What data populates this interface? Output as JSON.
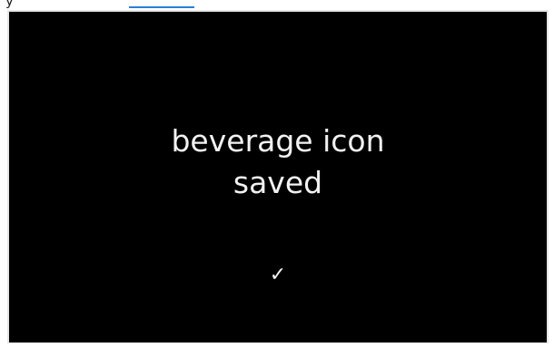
{
  "header": {
    "partial_text": "y",
    "link_text": ""
  },
  "screen": {
    "message_line1": "beverage icon",
    "message_line2": "saved",
    "confirm_icon": "checkmark-icon"
  }
}
